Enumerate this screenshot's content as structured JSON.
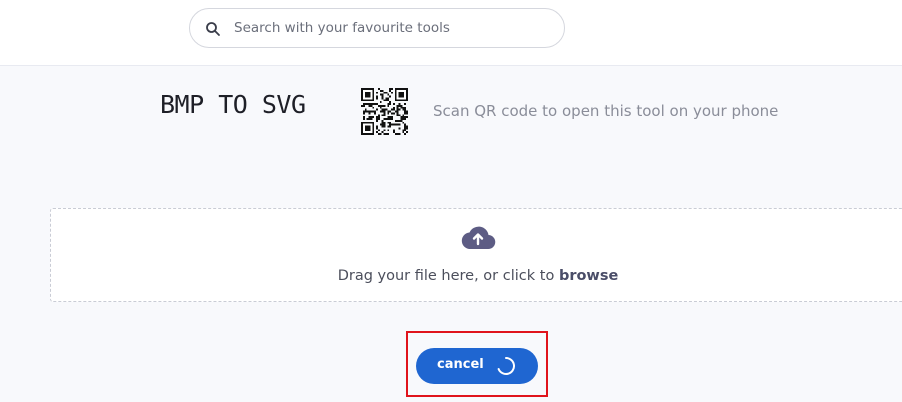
{
  "search": {
    "placeholder": "Search with your favourite tools",
    "icon": "search-icon"
  },
  "tool": {
    "title": "BMP TO SVG",
    "qr_icon": "qr-code-icon",
    "qr_caption": "Scan QR code to open this tool on your phone"
  },
  "dropzone": {
    "icon": "cloud-upload-icon",
    "text": "Drag your file here, or click to ",
    "browse_label": "browse"
  },
  "actions": {
    "cancel_label": "cancel",
    "spinner_icon": "loading-spinner-icon"
  },
  "colors": {
    "accent_blue": "#1f66d1",
    "highlight_red": "#e0141c",
    "upload_icon": "#5d5c84",
    "page_background": "#f8f9fc"
  }
}
